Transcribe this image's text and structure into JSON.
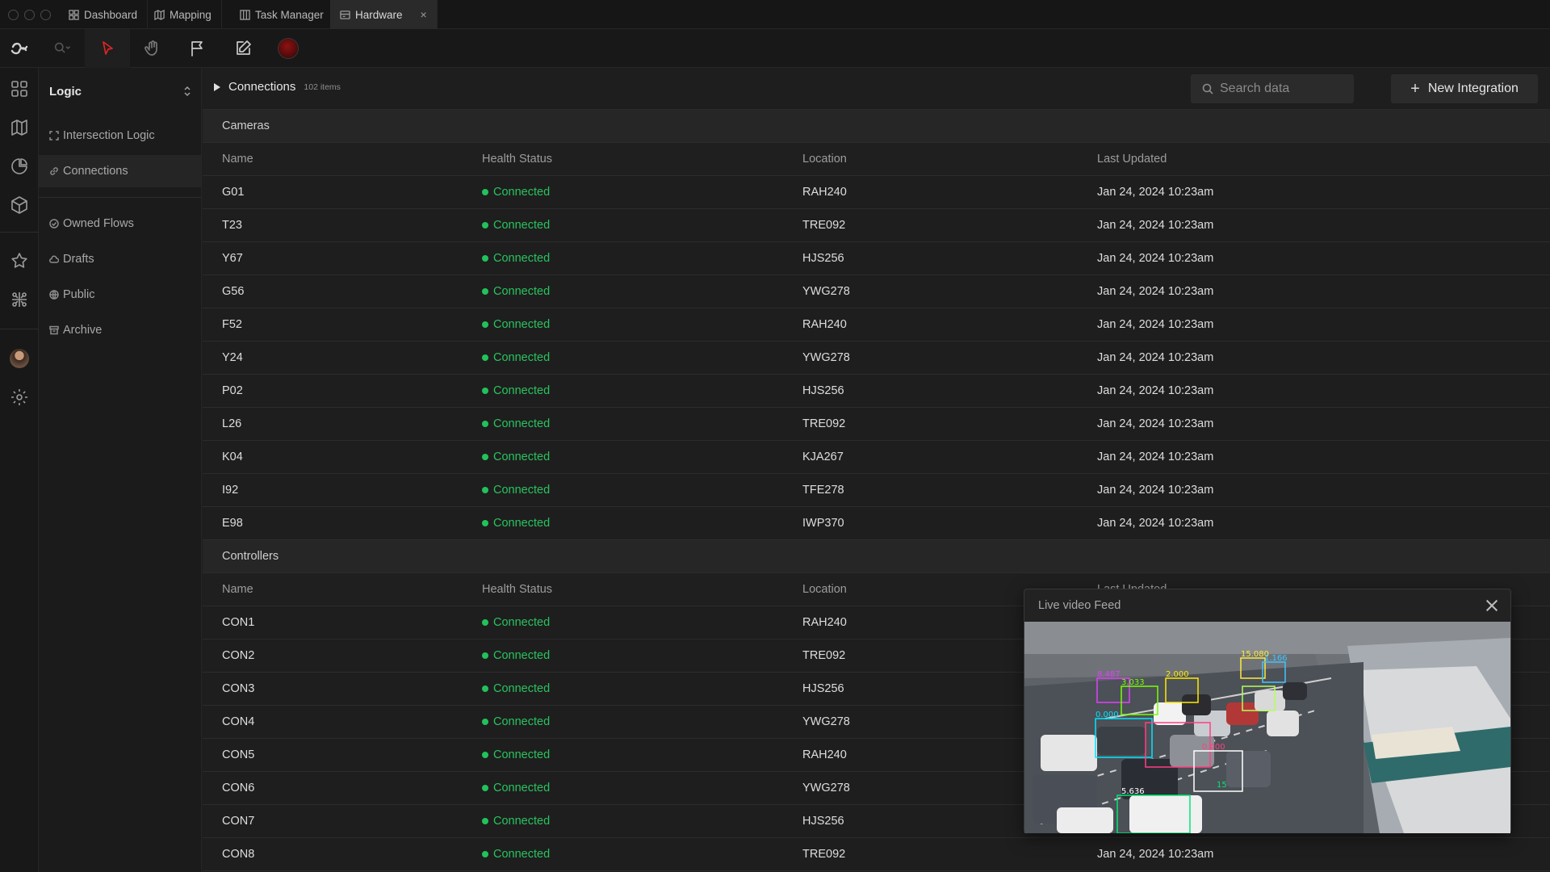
{
  "tabs": [
    {
      "label": "Dashboard",
      "icon": "grid-icon"
    },
    {
      "label": "Mapping",
      "icon": "map-icon"
    },
    {
      "label": "Task Manager",
      "icon": "columns-icon"
    },
    {
      "label": "Hardware",
      "icon": "hardware-icon",
      "active": true,
      "close": "×"
    }
  ],
  "sidebar": {
    "title": "Logic",
    "items": [
      {
        "label": "Intersection Logic",
        "icon": "expand-icon"
      },
      {
        "label": "Connections",
        "icon": "link-icon",
        "active": true
      },
      {
        "label": "Owned Flows",
        "icon": "check-circle-icon"
      },
      {
        "label": "Drafts",
        "icon": "cloud-icon"
      },
      {
        "label": "Public",
        "icon": "globe-icon"
      },
      {
        "label": "Archive",
        "icon": "archive-icon"
      }
    ]
  },
  "header": {
    "title": "Connections",
    "count": "102 items",
    "search_placeholder": "Search data",
    "new_button": "New Integration"
  },
  "columns": [
    "Name",
    "Health Status",
    "Location",
    "Last Updated"
  ],
  "status_color": "#29c35e",
  "groups": [
    {
      "name": "Cameras",
      "rows": [
        {
          "name": "G01",
          "status": "Connected",
          "location": "RAH240",
          "updated": "Jan 24, 2024 10:23am"
        },
        {
          "name": "T23",
          "status": "Connected",
          "location": "TRE092",
          "updated": "Jan 24, 2024 10:23am"
        },
        {
          "name": "Y67",
          "status": "Connected",
          "location": "HJS256",
          "updated": "Jan 24, 2024 10:23am"
        },
        {
          "name": "G56",
          "status": "Connected",
          "location": "YWG278",
          "updated": "Jan 24, 2024 10:23am"
        },
        {
          "name": "F52",
          "status": "Connected",
          "location": "RAH240",
          "updated": "Jan 24, 2024 10:23am"
        },
        {
          "name": "Y24",
          "status": "Connected",
          "location": "YWG278",
          "updated": "Jan 24, 2024 10:23am"
        },
        {
          "name": "P02",
          "status": "Connected",
          "location": "HJS256",
          "updated": "Jan 24, 2024 10:23am"
        },
        {
          "name": "L26",
          "status": "Connected",
          "location": "TRE092",
          "updated": "Jan 24, 2024 10:23am"
        },
        {
          "name": "K04",
          "status": "Connected",
          "location": "KJA267",
          "updated": "Jan 24, 2024 10:23am"
        },
        {
          "name": "I92",
          "status": "Connected",
          "location": "TFE278",
          "updated": "Jan 24, 2024 10:23am"
        },
        {
          "name": "E98",
          "status": "Connected",
          "location": "IWP370",
          "updated": "Jan 24, 2024 10:23am"
        }
      ]
    },
    {
      "name": "Controllers",
      "rows": [
        {
          "name": "CON1",
          "status": "Connected",
          "location": "RAH240",
          "updated": ""
        },
        {
          "name": "CON2",
          "status": "Connected",
          "location": "TRE092",
          "updated": ""
        },
        {
          "name": "CON3",
          "status": "Connected",
          "location": "HJS256",
          "updated": ""
        },
        {
          "name": "CON4",
          "status": "Connected",
          "location": "YWG278",
          "updated": ""
        },
        {
          "name": "CON5",
          "status": "Connected",
          "location": "RAH240",
          "updated": ""
        },
        {
          "name": "CON6",
          "status": "Connected",
          "location": "YWG278",
          "updated": ""
        },
        {
          "name": "CON7",
          "status": "Connected",
          "location": "HJS256",
          "updated": ""
        },
        {
          "name": "CON8",
          "status": "Connected",
          "location": "TRE092",
          "updated": "Jan 24, 2024 10:23am"
        }
      ]
    }
  ],
  "video": {
    "title": "Live video Feed",
    "detections": [
      "8.487",
      "3.033",
      "2.000",
      "15.080",
      "1.166",
      "0.000",
      "0.000",
      "5.636",
      "15"
    ]
  }
}
